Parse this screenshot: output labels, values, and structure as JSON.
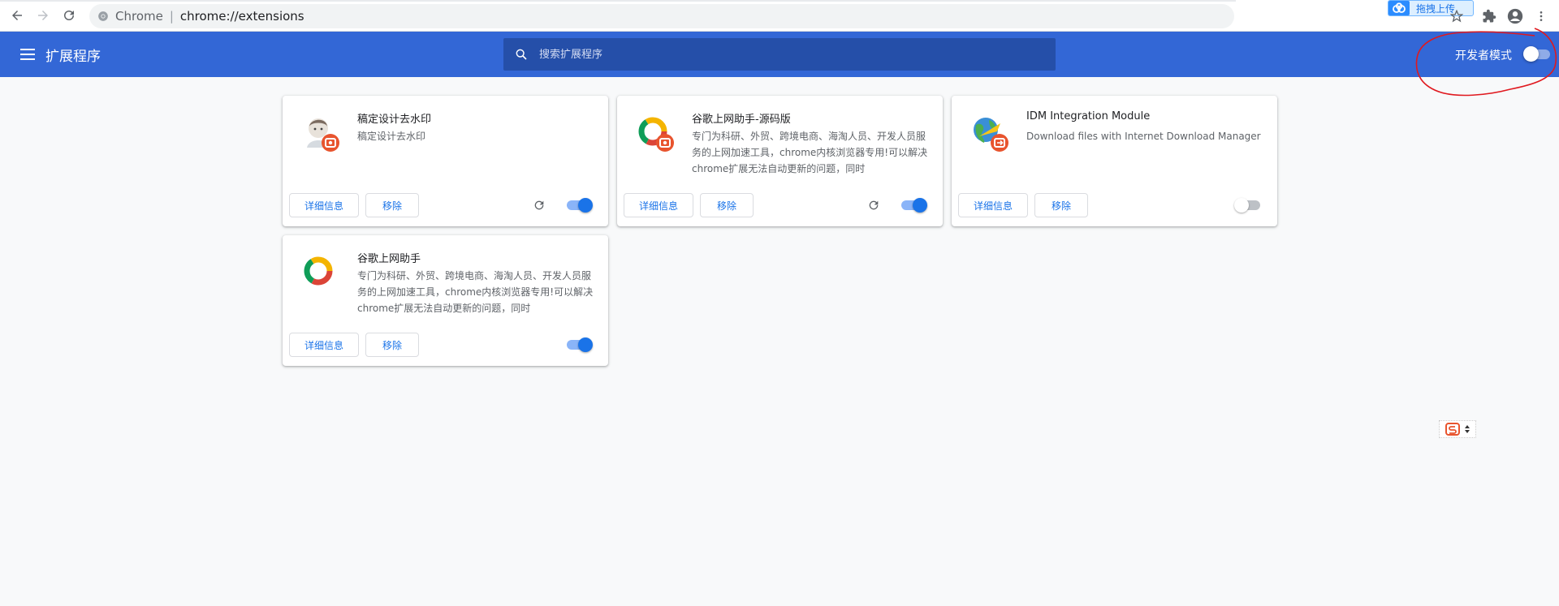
{
  "browser": {
    "site_name": "Chrome",
    "url": "chrome://extensions",
    "upload_label": "拖拽上传"
  },
  "header": {
    "title": "扩展程序",
    "search_placeholder": "搜索扩展程序",
    "dev_mode_label": "开发者模式",
    "dev_mode_enabled": false
  },
  "extensions": [
    {
      "name": "稿定设计去水印",
      "description": "稿定设计去水印",
      "details_label": "详细信息",
      "remove_label": "移除",
      "has_reload": true,
      "enabled": true,
      "icon": "avatar-icon"
    },
    {
      "name": "谷歌上网助手-源码版",
      "description": "专门为科研、外贸、跨境电商、海淘人员、开发人员服务的上网加速工具，chrome内核浏览器专用!可以解决chrome扩展无法自动更新的问题，同时",
      "details_label": "详细信息",
      "remove_label": "移除",
      "has_reload": true,
      "enabled": true,
      "icon": "chrome-ring-icon"
    },
    {
      "name": "IDM Integration Module",
      "description": "Download files with Internet Download Manager",
      "details_label": "详细信息",
      "remove_label": "移除",
      "has_reload": false,
      "enabled": false,
      "icon": "idm-globe-icon"
    },
    {
      "name": "谷歌上网助手",
      "description": "专门为科研、外贸、跨境电商、海淘人员、开发人员服务的上网加速工具，chrome内核浏览器专用!可以解决chrome扩展无法自动更新的问题，同时",
      "details_label": "详细信息",
      "remove_label": "移除",
      "has_reload": false,
      "enabled": true,
      "icon": "chrome-ring-icon"
    }
  ],
  "colors": {
    "header_bg": "#3367d6",
    "accent": "#1a73e8",
    "annotation": "#e0191f"
  }
}
